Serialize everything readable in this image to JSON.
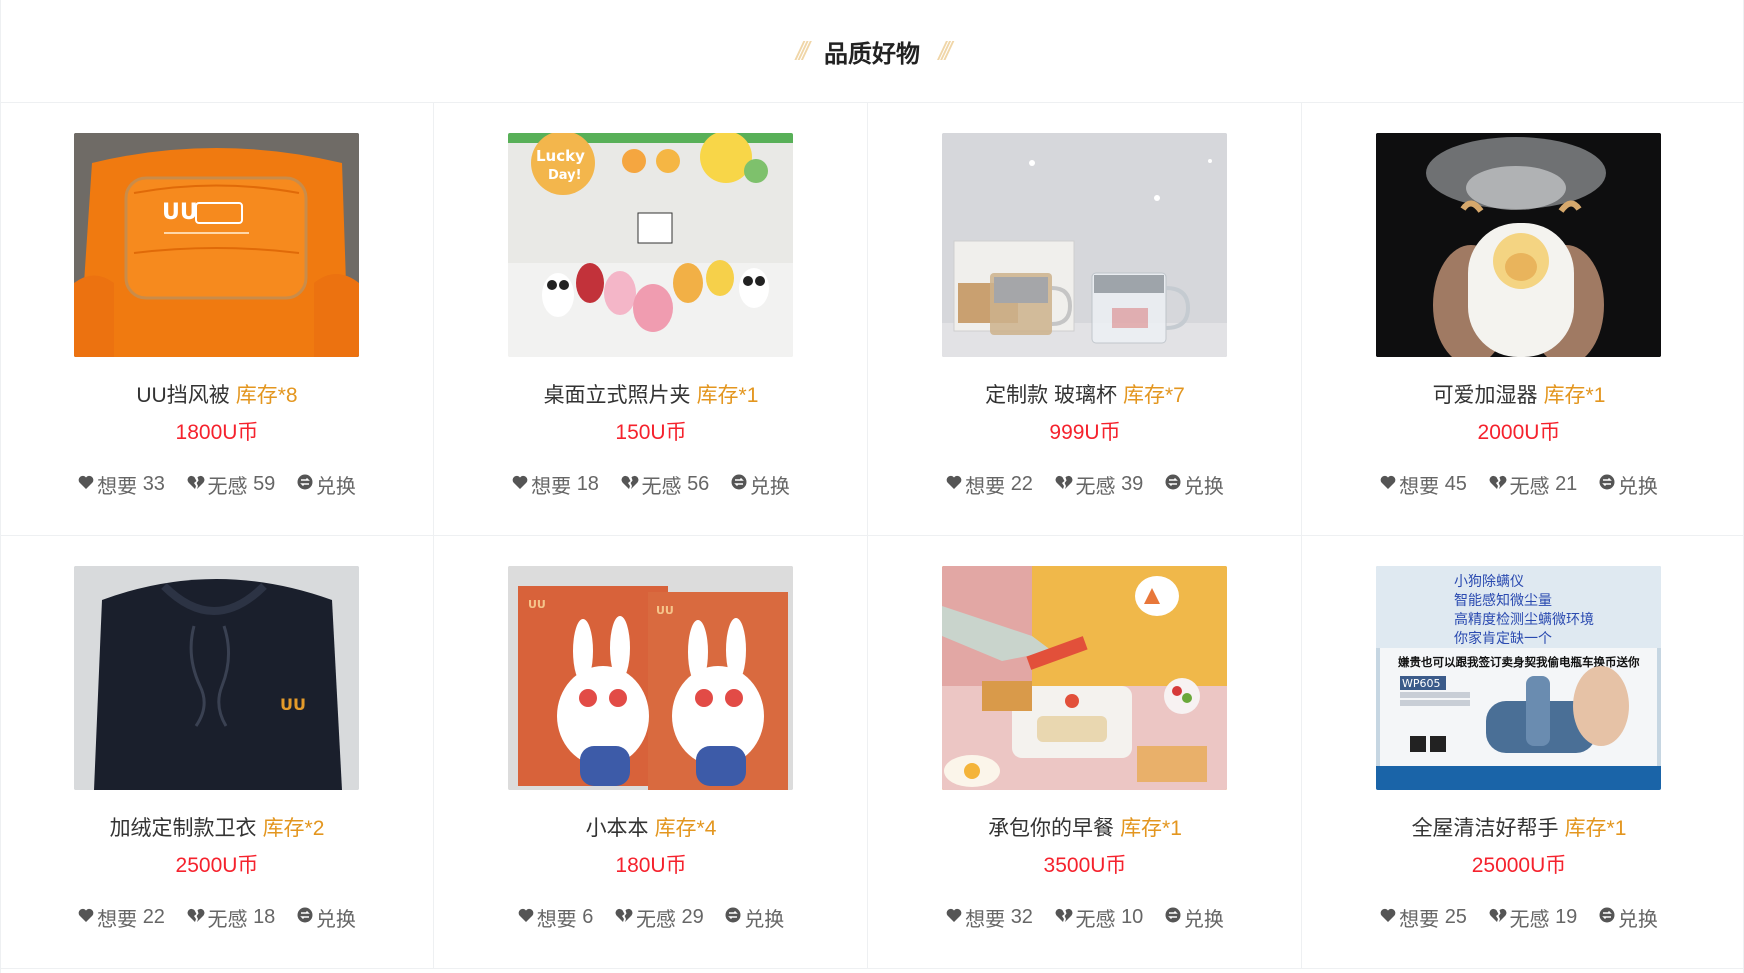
{
  "section": {
    "title": "品质好物",
    "deco_left": "///",
    "deco_right": "///"
  },
  "labels": {
    "want": "想要",
    "meh": "无感",
    "exchange": "兑换"
  },
  "products": [
    {
      "name": "UU挡风被",
      "stock": "库存*8",
      "price": "1800U币",
      "want": "33",
      "meh": "59",
      "image": "orange-windproof-quilt"
    },
    {
      "name": "桌面立式照片夹",
      "stock": "库存*1",
      "price": "150U币",
      "want": "18",
      "meh": "56",
      "image": "animal-photo-clips"
    },
    {
      "name": "定制款 玻璃杯",
      "stock": "库存*7",
      "price": "999U币",
      "want": "22",
      "meh": "39",
      "image": "glass-cups"
    },
    {
      "name": "可爱加湿器",
      "stock": "库存*1",
      "price": "2000U币",
      "want": "45",
      "meh": "21",
      "image": "cute-humidifier"
    },
    {
      "name": "加绒定制款卫衣",
      "stock": "库存*2",
      "price": "2500U币",
      "want": "22",
      "meh": "18",
      "image": "navy-hoodie"
    },
    {
      "name": "小本本",
      "stock": "库存*4",
      "price": "180U币",
      "want": "6",
      "meh": "29",
      "image": "rabbit-notebooks"
    },
    {
      "name": "承包你的早餐",
      "stock": "库存*1",
      "price": "3500U币",
      "want": "32",
      "meh": "10",
      "image": "breakfast-maker"
    },
    {
      "name": "全屋清洁好帮手",
      "stock": "库存*1",
      "price": "25000U币",
      "want": "25",
      "meh": "19",
      "image": "mite-vacuum"
    }
  ],
  "vacuum_box_text": [
    "小狗除螨仪",
    "智能感知微尘量",
    "高精度检测尘螨微环境",
    "你家肯定缺一个"
  ],
  "vacuum_box_banner": "嫌贵也可以跟我签订卖身契我偷电瓶车换币送你",
  "vacuum_model": "WP605",
  "colors": {
    "accent_stock": "#e3961f",
    "price": "#f5222d",
    "icon": "#555555"
  }
}
